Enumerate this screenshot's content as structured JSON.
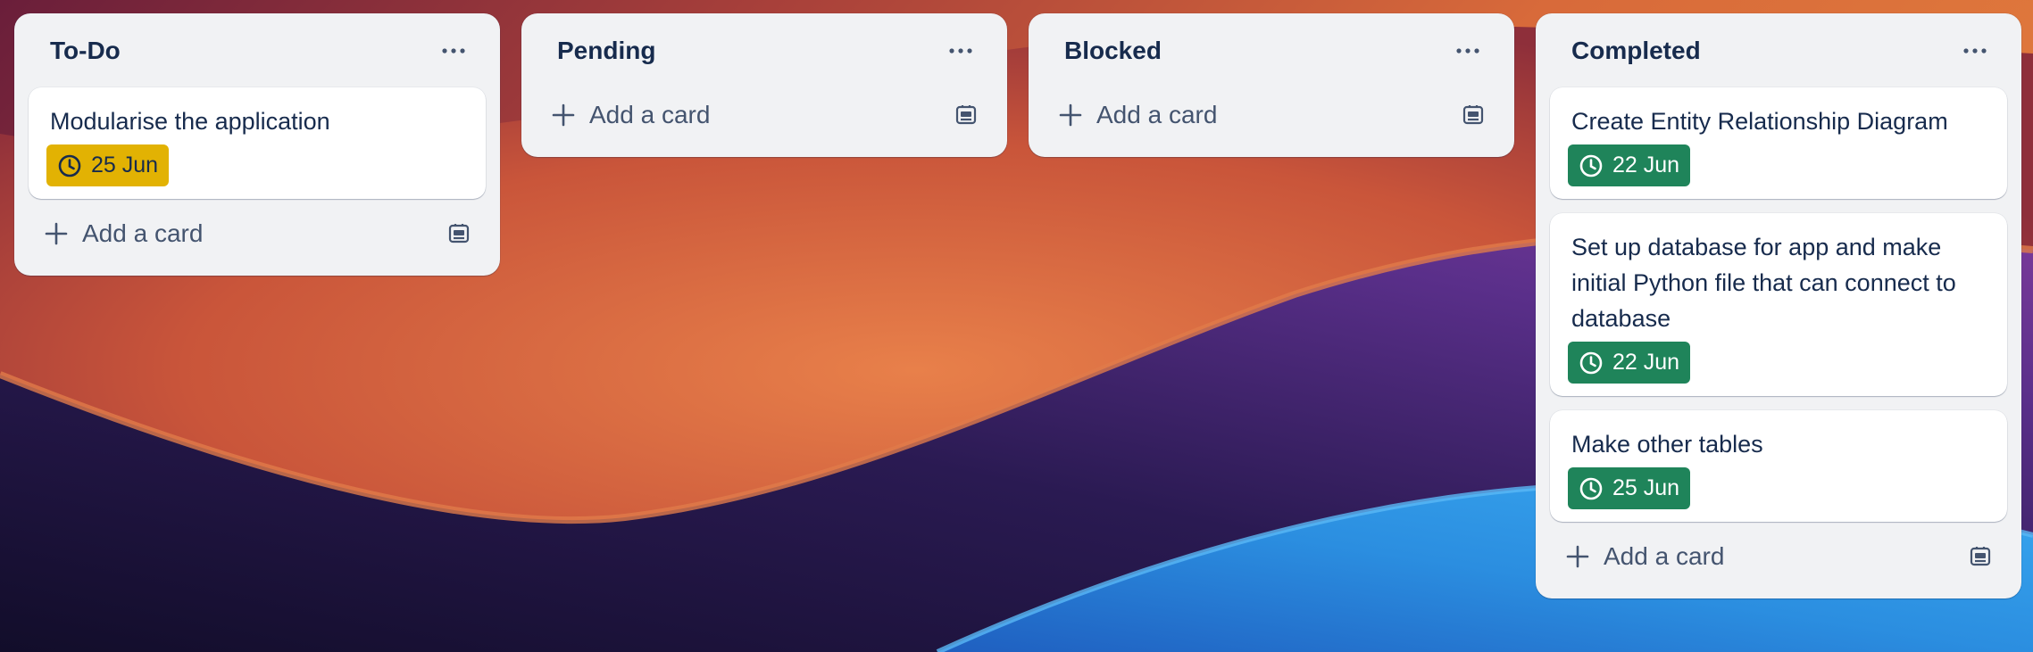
{
  "board": {
    "lists": [
      {
        "title": "To-Do",
        "cards": [
          {
            "title": "Modularise the application",
            "due": "25 Jun",
            "due_status": "due-soon"
          }
        ],
        "add_label": "Add a card"
      },
      {
        "title": "Pending",
        "cards": [],
        "add_label": "Add a card"
      },
      {
        "title": "Blocked",
        "cards": [],
        "add_label": "Add a card"
      },
      {
        "title": "Completed",
        "cards": [
          {
            "title": "Create Entity Relationship Diagram",
            "due": "22 Jun",
            "due_status": "complete"
          },
          {
            "title": "Set up database for app and make initial Python file that can connect to database",
            "due": "22 Jun",
            "due_status": "complete"
          },
          {
            "title": "Make other tables",
            "due": "25 Jun",
            "due_status": "complete"
          }
        ],
        "add_label": "Add a card"
      }
    ]
  },
  "icons": {
    "list_menu": "more-horizontal-icon",
    "due": "clock-icon",
    "add": "plus-icon",
    "template": "card-template-icon"
  },
  "colors": {
    "list_bg": "#f1f2f4",
    "due_soon": "#e2b203",
    "complete": "#1f845a",
    "text": "#172b4d",
    "subtle_text": "#44546f"
  }
}
